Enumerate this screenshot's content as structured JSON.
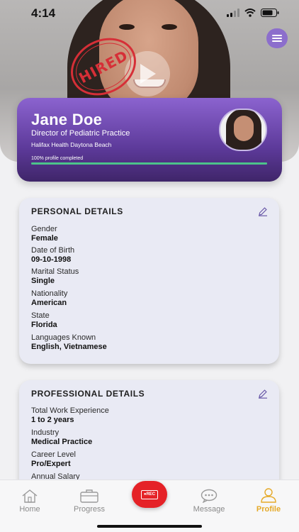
{
  "status_bar": {
    "time": "4:14"
  },
  "hero": {
    "stamp_text": "HIRED"
  },
  "profile": {
    "name": "Jane Doe",
    "title": "Director of Pediatric Practice",
    "organization": "Halifax Health Daytona Beach",
    "completion_text": "100% profile completed",
    "completion_fraction": 1.0
  },
  "personal_details": {
    "heading": "PERSONAL DETAILS",
    "fields": [
      {
        "label": "Gender",
        "value": "Female"
      },
      {
        "label": "Date of Birth",
        "value": "09-10-1998"
      },
      {
        "label": "Marital Status",
        "value": "Single"
      },
      {
        "label": "Nationality",
        "value": "American"
      },
      {
        "label": "State",
        "value": "Florida"
      },
      {
        "label": "Languages Known",
        "value": "English, Vietnamese"
      }
    ]
  },
  "professional_details": {
    "heading": "PROFESSIONAL DETAILS",
    "fields": [
      {
        "label": "Total Work Experience",
        "value": "1 to 2 years"
      },
      {
        "label": "Industry",
        "value": "Medical Practice"
      },
      {
        "label": "Career Level",
        "value": "Pro/Expert"
      },
      {
        "label": "Annual Salary",
        "value": ""
      }
    ]
  },
  "tabbar": {
    "home": "Home",
    "progress": "Progress",
    "rec": "●REC",
    "message": "Message",
    "profile": "Profile",
    "active_color": "#e5a928"
  },
  "colors": {
    "accent": "#5d3a9a",
    "menu": "#8c6ecc",
    "stamp": "#d62f37",
    "record": "#e52227"
  },
  "icons": [
    "menu-icon",
    "play-icon",
    "edit-icon",
    "home-icon",
    "briefcase-icon",
    "message-icon",
    "user-icon",
    "signal-icon",
    "wifi-icon",
    "battery-icon"
  ]
}
